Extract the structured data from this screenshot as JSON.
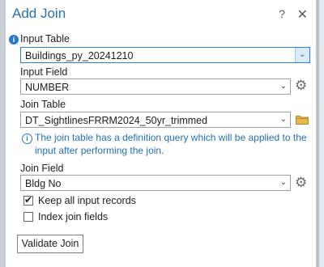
{
  "dialog": {
    "title": "Add Join",
    "help_label": "?",
    "close_label": "✕"
  },
  "input_table": {
    "label": "Input Table",
    "value": "Buildings_py_20241210",
    "info_icon": "info-icon",
    "chevron": "chevron-down-icon"
  },
  "input_field": {
    "label": "Input Field",
    "value": "NUMBER",
    "chevron": "chevron-down-icon",
    "settings_icon": "gear-icon"
  },
  "join_table": {
    "label": "Join Table",
    "value": "DT_SightlinesFRRM2024_50yr_trimmed",
    "chevron": "chevron-down-icon",
    "browse_icon": "folder-icon"
  },
  "info_message": "The join table has a definition query which will be applied to the input after performing the join.",
  "join_field": {
    "label": "Join Field",
    "value": "Bldg No",
    "chevron": "chevron-down-icon",
    "settings_icon": "gear-icon"
  },
  "keep_all": {
    "label": "Keep all input records",
    "checked": true
  },
  "index_fields": {
    "label": "Index join fields",
    "checked": false
  },
  "validate_button": "Validate Join",
  "colors": {
    "accent": "#2a6fb5",
    "info": "#2470b8",
    "border": "#9aa0a6"
  }
}
